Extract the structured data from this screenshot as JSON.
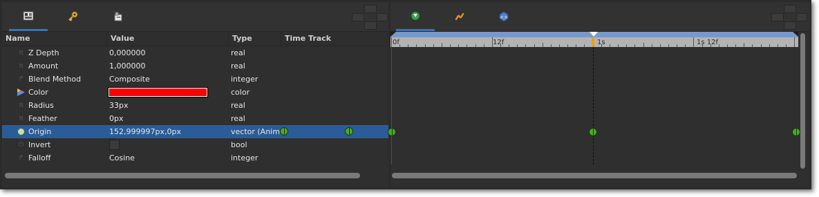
{
  "params_panel": {
    "tabs": [
      {
        "icon": "params-panel-icon",
        "active": true
      },
      {
        "icon": "key-icon",
        "active": false
      },
      {
        "icon": "library-icon",
        "active": false
      }
    ],
    "columns": {
      "name": "Name",
      "value": "Value",
      "type": "Type",
      "time_track": "Time Track"
    },
    "rows": [
      {
        "icon": "pi-icon",
        "name": "Z Depth",
        "value": "0,000000",
        "type": "real"
      },
      {
        "icon": "pi-icon",
        "name": "Amount",
        "value": "1,000000",
        "type": "real"
      },
      {
        "icon": "integer-icon",
        "name": "Blend Method",
        "value": "Composite",
        "type": "integer"
      },
      {
        "icon": "color-icon",
        "name": "Color",
        "value": "",
        "swatch": "#ff0000",
        "type": "color"
      },
      {
        "icon": "pi-icon",
        "name": "Radius",
        "value": "33px",
        "type": "real"
      },
      {
        "icon": "pi-icon",
        "name": "Feather",
        "value": "0px",
        "type": "real"
      },
      {
        "icon": "vector-icon",
        "name": "Origin",
        "value": "152,999997px,0px",
        "type": "vector (Animated)",
        "selected": true
      },
      {
        "icon": "bool-icon",
        "name": "Invert",
        "value": "",
        "checkbox": false,
        "type": "bool"
      },
      {
        "icon": "integer-icon",
        "name": "Falloff",
        "value": "Cosine",
        "type": "integer"
      }
    ]
  },
  "timetrack_panel": {
    "tabs": [
      {
        "icon": "timetrack-icon",
        "active": true
      },
      {
        "icon": "curves-icon",
        "active": false
      },
      {
        "icon": "canvas-browser-icon",
        "active": false
      }
    ],
    "ruler_labels": [
      "0f",
      "12f",
      "1s",
      "1s 12f"
    ],
    "current_time_color": "#e8a020"
  },
  "colors": {
    "selection": "#2a5c99",
    "waypoint": "#4caa2a",
    "swatch": "#ff0000"
  }
}
